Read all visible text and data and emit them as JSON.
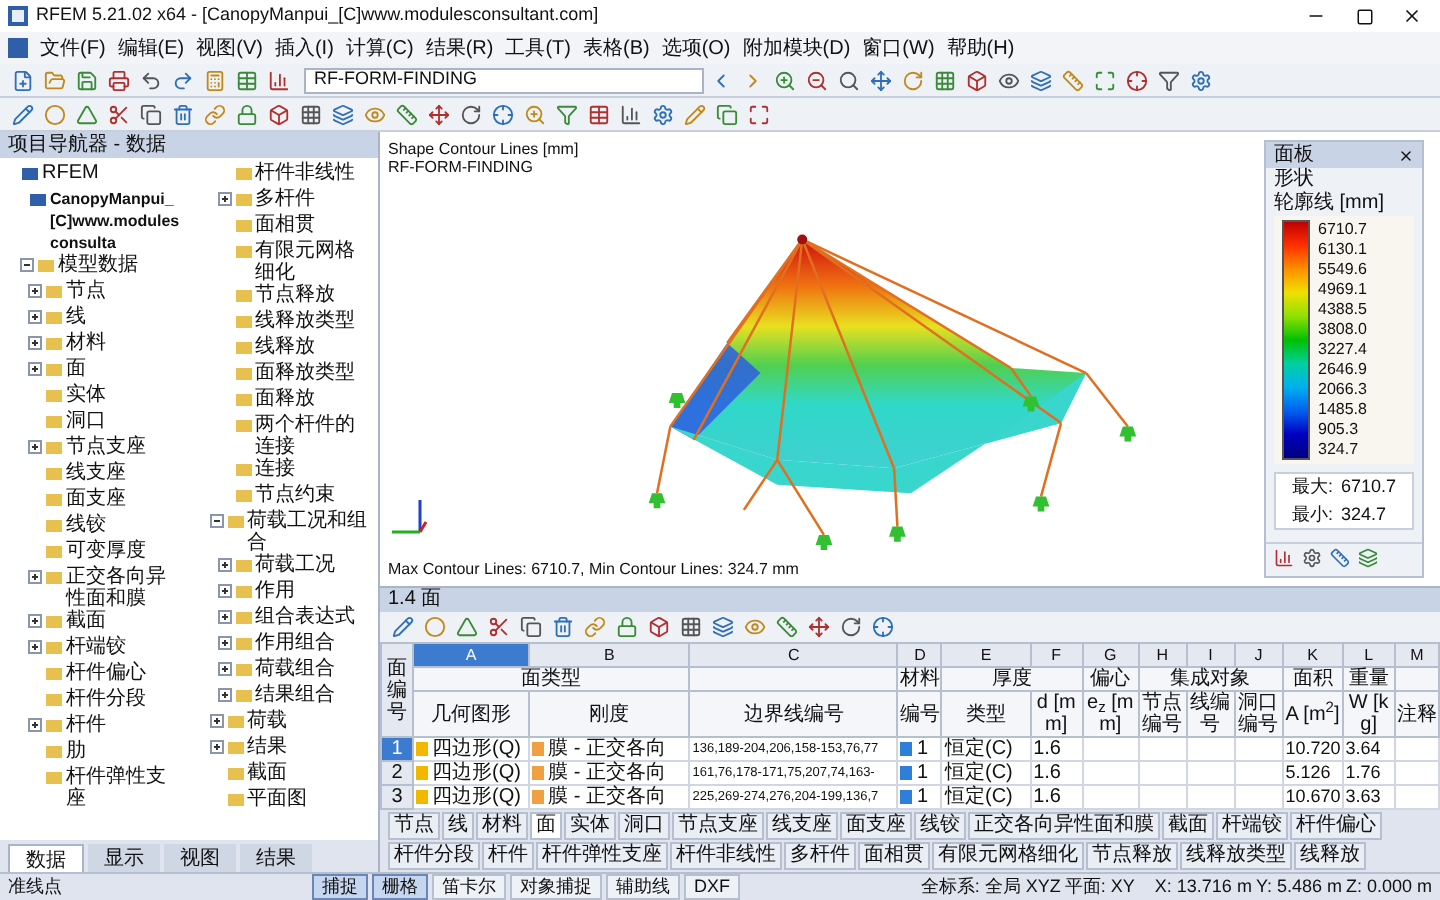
{
  "window": {
    "title": "RFEM 5.21.02 x64 - [CanopyManpui_[C]www.modulesconsultant.com]"
  },
  "menu": [
    "文件(F)",
    "编辑(E)",
    "视图(V)",
    "插入(I)",
    "计算(C)",
    "结果(R)",
    "工具(T)",
    "表格(B)",
    "选项(O)",
    "附加模块(D)",
    "窗口(W)",
    "帮助(H)"
  ],
  "toolbar": {
    "module_select": "RF-FORM-FINDING"
  },
  "navigator": {
    "title": "项目导航器 - 数据",
    "tree": [
      {
        "label": "RFEM",
        "children": [
          {
            "label": "CanopyManpui_[C]www.modulesconsulta",
            "children": [
              {
                "label": "模型数据",
                "expanded": true,
                "children": [
                  {
                    "label": "节点",
                    "expanded": false
                  },
                  {
                    "label": "线",
                    "expanded": false
                  },
                  {
                    "label": "材料",
                    "expanded": false
                  },
                  {
                    "label": "面",
                    "expanded": false
                  },
                  {
                    "label": "实体"
                  },
                  {
                    "label": "洞口"
                  },
                  {
                    "label": "节点支座",
                    "expanded": false
                  },
                  {
                    "label": "线支座"
                  },
                  {
                    "label": "面支座"
                  },
                  {
                    "label": "线铰"
                  },
                  {
                    "label": "可变厚度"
                  },
                  {
                    "label": "正交各向异性面和膜",
                    "expanded": false
                  },
                  {
                    "label": "截面",
                    "expanded": false
                  },
                  {
                    "label": "杆端铰",
                    "expanded": false
                  },
                  {
                    "label": "杆件偏心"
                  },
                  {
                    "label": "杆件分段"
                  },
                  {
                    "label": "杆件",
                    "expanded": false
                  },
                  {
                    "label": "肋"
                  },
                  {
                    "label": "杆件弹性支座"
                  },
                  {
                    "label": "杆件非线性"
                  },
                  {
                    "label": "多杆件",
                    "expanded": false
                  },
                  {
                    "label": "面相贯"
                  },
                  {
                    "label": "有限元网格细化"
                  },
                  {
                    "label": "节点释放"
                  },
                  {
                    "label": "线释放类型"
                  },
                  {
                    "label": "线释放"
                  },
                  {
                    "label": "面释放类型"
                  },
                  {
                    "label": "面释放"
                  },
                  {
                    "label": "两个杆件的连接"
                  },
                  {
                    "label": "连接"
                  },
                  {
                    "label": "节点约束"
                  }
                ]
              },
              {
                "label": "荷载工况和组合",
                "expanded": true,
                "children": [
                  {
                    "label": "荷载工况",
                    "expanded": false
                  },
                  {
                    "label": "作用",
                    "expanded": false
                  },
                  {
                    "label": "组合表达式",
                    "expanded": false
                  },
                  {
                    "label": "作用组合",
                    "expanded": false
                  },
                  {
                    "label": "荷载组合",
                    "expanded": false
                  },
                  {
                    "label": "结果组合",
                    "expanded": false
                  }
                ]
              },
              {
                "label": "荷载",
                "expanded": false
              },
              {
                "label": "结果",
                "expanded": false
              },
              {
                "label": "截面"
              },
              {
                "label": "平面图"
              }
            ]
          }
        ]
      }
    ],
    "tabs": [
      {
        "label": "数据",
        "selected": true
      },
      {
        "label": "显示",
        "selected": false
      },
      {
        "label": "视图",
        "selected": false
      },
      {
        "label": "结果",
        "selected": false
      }
    ]
  },
  "viewport": {
    "title": "Shape Contour Lines [mm]",
    "subtitle": "RF-FORM-FINDING",
    "footer": "Max Contour Lines: 6710.7, Min Contour Lines: 324.7 mm"
  },
  "legend_panel": {
    "title": "面板",
    "heading": "形状",
    "unit": "轮廓线 [mm]",
    "values": [
      "6710.7",
      "6130.1",
      "5549.6",
      "4969.1",
      "4388.5",
      "3808.0",
      "3227.4",
      "2646.9",
      "2066.3",
      "1485.8",
      "905.3",
      "324.7"
    ],
    "max_label": "最大:",
    "max": "6710.7",
    "min_label": "最小:",
    "min": "324.7"
  },
  "table_panel": {
    "title": "1.4 面",
    "row_header": "面编号",
    "groups": [
      {
        "label": "面类型",
        "columns": [
          {
            "letter": "A",
            "selected": true,
            "label": "几何图形"
          },
          {
            "letter": "B",
            "selected": false,
            "label": "刚度"
          }
        ]
      },
      {
        "columns": [
          {
            "letter": "C",
            "selected": false,
            "label": "边界线编号"
          }
        ]
      },
      {
        "label": "材料",
        "columns": [
          {
            "letter": "D",
            "selected": false,
            "label": "编号"
          }
        ]
      },
      {
        "label": "厚度",
        "columns": [
          {
            "letter": "E",
            "selected": false,
            "label": "类型"
          },
          {
            "letter": "F",
            "selected": false,
            "label": "d [mm]"
          }
        ]
      },
      {
        "label": "偏心",
        "columns": [
          {
            "letter": "G",
            "selected": false,
            "label": "e$_{z}$ [mm]"
          }
        ]
      },
      {
        "label": "集成对象",
        "columns": [
          {
            "letter": "H",
            "selected": false,
            "label": "节点编号"
          },
          {
            "letter": "I",
            "selected": false,
            "label": "线编号"
          },
          {
            "letter": "J",
            "selected": false,
            "label": "洞口编号"
          }
        ]
      },
      {
        "label": "面积",
        "columns": [
          {
            "letter": "K",
            "selected": false,
            "label": "A [m$^{2}$]"
          }
        ]
      },
      {
        "label": "重量",
        "columns": [
          {
            "letter": "L",
            "selected": false,
            "label": "W [kg]"
          }
        ]
      },
      {
        "columns": [
          {
            "letter": "M",
            "selected": false,
            "label": "注释"
          }
        ]
      }
    ],
    "rows": [
      {
        "number": "1",
        "selected": true,
        "cells": [
          {
            "text": "四边形(Q)",
            "color": "#f2b800"
          },
          {
            "text": "膜 - 正交各向",
            "color": "#f0a040"
          },
          {
            "text": "136,189-204,206,158-153,76,77"
          },
          {
            "text": "1",
            "color": "#2d7fd8"
          },
          {
            "text": "恒定(C)"
          },
          {
            "text": "1.6"
          },
          null,
          null,
          null,
          null,
          {
            "text": "10.720"
          },
          {
            "text": "3.64"
          },
          null
        ]
      },
      {
        "number": "2",
        "selected": false,
        "cells": [
          {
            "text": "四边形(Q)",
            "color": "#f2b800"
          },
          {
            "text": "膜 - 正交各向",
            "color": "#f0a040"
          },
          {
            "text": "161,76,178-171,75,207,74,163-"
          },
          {
            "text": "1",
            "color": "#2d7fd8"
          },
          {
            "text": "恒定(C)"
          },
          {
            "text": "1.6"
          },
          null,
          null,
          null,
          null,
          {
            "text": "5.126"
          },
          {
            "text": "1.76"
          },
          null
        ]
      },
      {
        "number": "3",
        "selected": false,
        "cells": [
          {
            "text": "四边形(Q)",
            "color": "#f2b800"
          },
          {
            "text": "膜 - 正交各向",
            "color": "#f0a040"
          },
          {
            "text": "225,269-274,276,204-199,136,7"
          },
          {
            "text": "1",
            "color": "#2d7fd8"
          },
          {
            "text": "恒定(C)"
          },
          {
            "text": "1.6"
          },
          null,
          null,
          null,
          null,
          {
            "text": "10.670"
          },
          {
            "text": "3.63"
          },
          null
        ]
      }
    ],
    "tabs": [
      {
        "label": "节点",
        "selected": false
      },
      {
        "label": "线",
        "selected": false
      },
      {
        "label": "材料",
        "selected": false
      },
      {
        "label": "面",
        "selected": true
      },
      {
        "label": "实体",
        "selected": false
      },
      {
        "label": "洞口",
        "selected": false
      },
      {
        "label": "节点支座",
        "selected": false
      },
      {
        "label": "线支座",
        "selected": false
      },
      {
        "label": "面支座",
        "selected": false
      },
      {
        "label": "线铰",
        "selected": false
      },
      {
        "label": "正交各向异性面和膜",
        "selected": false
      },
      {
        "label": "截面",
        "selected": false
      },
      {
        "label": "杆端铰",
        "selected": false
      },
      {
        "label": "杆件偏心",
        "selected": false
      },
      {
        "label": "杆件分段",
        "selected": false
      },
      {
        "label": "杆件",
        "selected": false
      },
      {
        "label": "杆件弹性支座",
        "selected": false
      },
      {
        "label": "杆件非线性",
        "selected": false
      },
      {
        "label": "多杆件",
        "selected": false
      },
      {
        "label": "面相贯",
        "selected": false
      },
      {
        "label": "有限元网格细化",
        "selected": false
      },
      {
        "label": "节点释放",
        "selected": false
      },
      {
        "label": "线释放类型",
        "selected": false
      },
      {
        "label": "线释放",
        "selected": false
      }
    ]
  },
  "status_bar": {
    "message": "准线点",
    "toggles": [
      {
        "label": "捕捉",
        "on": true
      },
      {
        "label": "栅格",
        "on": true
      },
      {
        "label": "笛卡尔",
        "on": false
      },
      {
        "label": "对象捕捉",
        "on": false
      },
      {
        "label": "辅助线",
        "on": false
      },
      {
        "label": "DXF",
        "on": false
      }
    ],
    "coordinate_system": "全标系: 全局 XYZ",
    "plane": "平面: XY",
    "x": "X: 13.716 m",
    "y": "Y: 5.486 m",
    "z": "Z: 0.000 m"
  }
}
